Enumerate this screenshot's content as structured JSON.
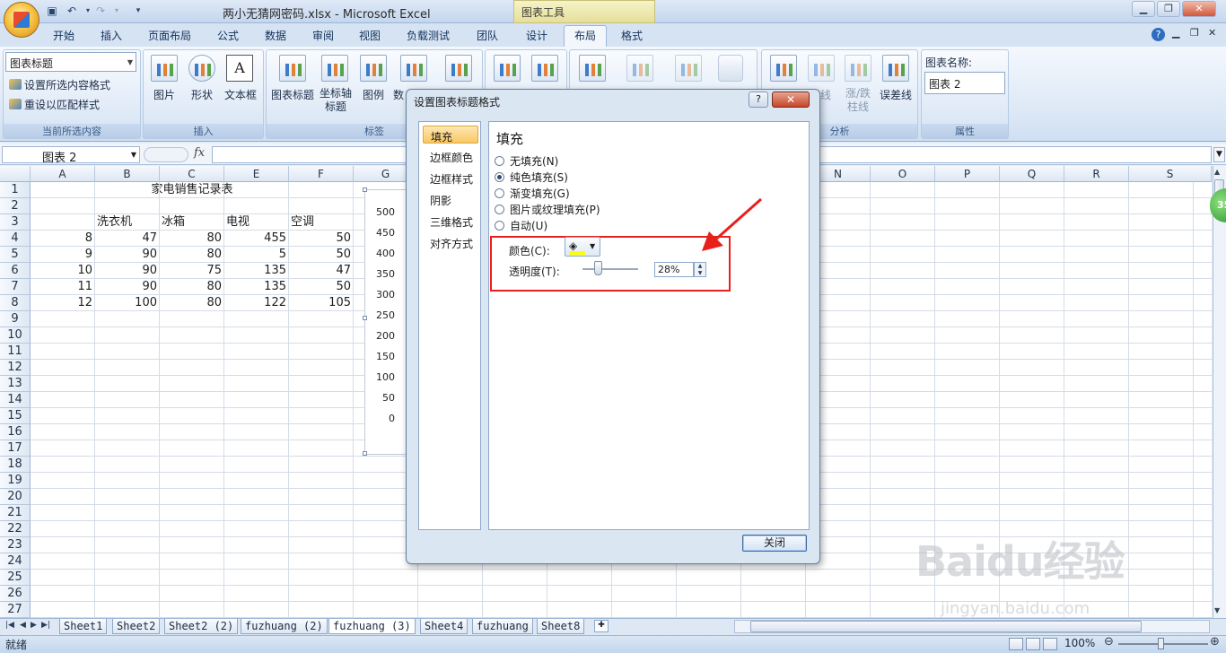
{
  "window": {
    "doc_title": "两小无猜网密码.xlsx - Microsoft Excel",
    "context_tab_group": "图表工具",
    "min_btn": "▁",
    "restore_btn": "❐",
    "close_btn": "✕"
  },
  "tabs": [
    "开始",
    "插入",
    "页面布局",
    "公式",
    "数据",
    "审阅",
    "视图",
    "负载测试",
    "团队",
    "设计",
    "布局",
    "格式"
  ],
  "active_tab": "布局",
  "ribbon": {
    "current_selection_combo": "图表标题",
    "format_selection": "设置所选内容格式",
    "reset_style": "重设以匹配样式",
    "group_current": "当前所选内容",
    "insert_items": [
      "图片",
      "形状",
      "文本框"
    ],
    "group_insert": "插入",
    "label_items": [
      "图表标题",
      "坐标轴\n标题",
      "图例",
      "数"
    ],
    "group_labels": "标签",
    "analysis_items": [
      "线",
      "涨/跌\n柱线",
      "误差线"
    ],
    "group_analysis": "分析",
    "chart_name_label": "图表名称:",
    "chart_name_value": "图表 2",
    "group_properties": "属性"
  },
  "formula_bar": {
    "name_box": "图表 2",
    "fx": "fx",
    "value": ""
  },
  "columns": [
    "A",
    "B",
    "C",
    "E",
    "F",
    "G",
    "N",
    "O",
    "P",
    "Q",
    "R",
    "S"
  ],
  "rows": [
    "1",
    "2",
    "3",
    "4",
    "5",
    "6",
    "7",
    "8",
    "9",
    "10",
    "11",
    "12",
    "13",
    "14",
    "15",
    "16",
    "17",
    "18",
    "19",
    "20",
    "21",
    "22",
    "23",
    "24",
    "25",
    "26",
    "27"
  ],
  "sheet": {
    "title": "家电销售记录表",
    "headers": [
      "洗衣机",
      "冰箱",
      "电视",
      "空调"
    ],
    "data": [
      [
        "8",
        "47",
        "80",
        "455",
        "50"
      ],
      [
        "9",
        "90",
        "80",
        "5",
        "50"
      ],
      [
        "10",
        "90",
        "75",
        "135",
        "47"
      ],
      [
        "11",
        "90",
        "80",
        "135",
        "50"
      ],
      [
        "12",
        "100",
        "80",
        "122",
        "105"
      ]
    ]
  },
  "chart_axis_ticks": [
    "500",
    "450",
    "400",
    "350",
    "300",
    "250",
    "200",
    "150",
    "100",
    "50",
    "0"
  ],
  "dialog": {
    "title": "设置图表标题格式",
    "help": "?",
    "close": "✕",
    "nav": [
      "填充",
      "边框颜色",
      "边框样式",
      "阴影",
      "三维格式",
      "对齐方式"
    ],
    "nav_active": "填充",
    "panel_heading": "填充",
    "fill_options": [
      "无填充(N)",
      "纯色填充(S)",
      "渐变填充(G)",
      "图片或纹理填充(P)",
      "自动(U)"
    ],
    "fill_selected": "纯色填充(S)",
    "color_label": "颜色(C):",
    "transparency_label": "透明度(T):",
    "transparency_value": "28%",
    "transparency_fraction": 0.28,
    "fill_color": "#ffff00",
    "close_button": "关闭"
  },
  "sheet_tabs": [
    "Sheet1",
    "Sheet2",
    "Sheet2 (2)",
    "fuzhuang (2)",
    "fuzhuang (3)",
    "Sheet4",
    "fuzhuang",
    "Sheet8"
  ],
  "active_sheet": "fuzhuang (3)",
  "status": {
    "ready": "就绪",
    "zoom": "100%"
  },
  "badge": "35",
  "watermark": {
    "brand": "Baidu经验",
    "url": "jingyan.baidu.com"
  },
  "colors": {
    "highlight_red": "#e8201a",
    "accent_blue": "#2b579a"
  }
}
